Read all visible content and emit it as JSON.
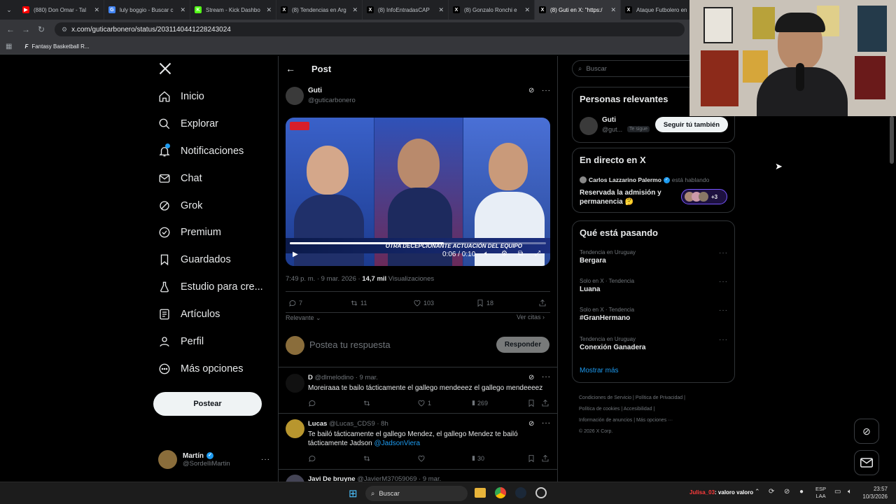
{
  "browser": {
    "tabs": [
      {
        "title": "(880) Don Omar - Tal",
        "fav_color": "#ff0000",
        "fav_glyph": "▶"
      },
      {
        "title": "luly boggio - Buscar c",
        "fav_color": "#4285f4",
        "fav_glyph": "G"
      },
      {
        "title": "Stream - Kick Dashbo",
        "fav_color": "#53fc18",
        "fav_glyph": "K"
      },
      {
        "title": "(8) Tendencias en Arg",
        "fav_color": "#000000",
        "fav_glyph": "X"
      },
      {
        "title": "(8) InfoEntradasCAP",
        "fav_color": "#000000",
        "fav_glyph": "X"
      },
      {
        "title": "(8) Gonzalo Ronchi e",
        "fav_color": "#000000",
        "fav_glyph": "X"
      },
      {
        "title": "(8) Guti en X: \"https:/",
        "fav_color": "#000000",
        "fav_glyph": "X"
      },
      {
        "title": "Ataque Futbolero en",
        "fav_color": "#000000",
        "fav_glyph": "X"
      }
    ],
    "url": "x.com/guticarbonero/status/2031140441228243024",
    "bookmark": "Fantasy Basketball R..."
  },
  "nav": {
    "items": [
      {
        "label": "Inicio",
        "icon": "home-icon"
      },
      {
        "label": "Explorar",
        "icon": "search-icon"
      },
      {
        "label": "Notificaciones",
        "icon": "bell-icon"
      },
      {
        "label": "Chat",
        "icon": "mail-icon"
      },
      {
        "label": "Grok",
        "icon": "grok-icon"
      },
      {
        "label": "Premium",
        "icon": "verified-icon"
      },
      {
        "label": "Guardados",
        "icon": "bookmark-icon"
      },
      {
        "label": "Estudio para cre...",
        "icon": "flask-icon"
      },
      {
        "label": "Artículos",
        "icon": "article-icon"
      },
      {
        "label": "Perfil",
        "icon": "person-icon"
      },
      {
        "label": "Más opciones",
        "icon": "more-icon"
      }
    ],
    "post_button": "Postear",
    "account": {
      "name": "Martín",
      "handle": "@SordelliMartin"
    }
  },
  "post": {
    "header_title": "Post",
    "author": "Guti",
    "handle": "@guticarbonero",
    "video_banner": "OTRA DECEPCIONANTE ACTUACIÓN DEL EQUIPO",
    "video_time": "0:06 / 0:10",
    "video_progress": 0.6,
    "timestamp": "7:49 p. m. · 9 mar. 2026 · ",
    "views_count": "14,7 mil",
    "views_label": " Visualizaciones",
    "replies": "7",
    "reposts": "11",
    "likes": "103",
    "bookmarks": "18",
    "sort_label": "Relevante",
    "quotes_link": "Ver citas",
    "reply_placeholder": "Postea tu respuesta",
    "reply_button": "Responder"
  },
  "replies": [
    {
      "name": "D",
      "handle": "@dlmelodino · 9 mar.",
      "text": "Moreiraaa te bailo tácticamente el gallego mendeeez el gallego mendeeeez",
      "mention": "",
      "comments": "",
      "reposts": "",
      "likes": "1",
      "views": "269"
    },
    {
      "name": "Lucas",
      "handle": "@Lucas_CDS9 · 8h",
      "text": "Te bailó tácticamente el gallego Mendez, el gallego Mendez te bailó tácticamente Jadson ",
      "mention": "@JadsonViera",
      "comments": "",
      "reposts": "",
      "likes": "",
      "views": "30"
    },
    {
      "name": "Javi De bruyne",
      "handle": "@JavierM37059069 · 9 mar."
    }
  ],
  "sidebar": {
    "search_placeholder": "Buscar",
    "relevant_title": "Personas relevantes",
    "relevant_person": {
      "name": "Guti",
      "handle": "@gut...",
      "badge": "Te sigue",
      "follow_button": "Seguir tú también"
    },
    "live_title": "En directo en X",
    "live": {
      "host": "Carlos Lazzarino Palermo",
      "status": "está hablando",
      "topic": "Reservada la admisión y permanencia 🤔",
      "extra": "+3"
    },
    "trends_title": "Qué está pasando",
    "trends": [
      {
        "meta": "Tendencia en Uruguay",
        "name": "Bergara"
      },
      {
        "meta": "Solo en X · Tendencia",
        "name": "Luana"
      },
      {
        "meta": "Solo en X · Tendencia",
        "name": "#GranHermano"
      },
      {
        "meta": "Tendencia en Uruguay",
        "name": "Conexión Ganadera"
      }
    ],
    "show_more": "Mostrar más",
    "footer": [
      "Condiciones de Servicio",
      "Política de Privacidad",
      "Política de cookies",
      "Accesibilidad",
      "Información de anuncios",
      "Más opciones ···",
      "© 2026 X Corp."
    ]
  },
  "taskbar": {
    "search": "Buscar",
    "chat_user": "Julisa_03",
    "chat_text": ": valoro valoro",
    "lang": "ESP",
    "lang_sub": "LAA",
    "time": "23:57",
    "date": "10/3/2026"
  },
  "colors": {
    "accent": "#1d9bf0",
    "background": "#000000",
    "border": "#2f3336",
    "muted": "#71767b"
  }
}
